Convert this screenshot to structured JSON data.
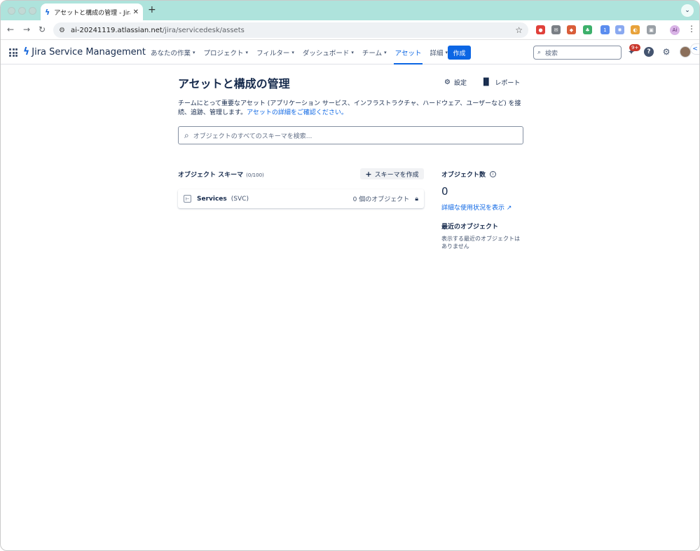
{
  "browser": {
    "tab_title": "アセットと構成の管理 - Jira Se",
    "url_host": "ai-20241119.atlassian.net",
    "url_path": "/jira/servicedesk/assets",
    "profile_initial": "Ai"
  },
  "app": {
    "product_name": "Jira Service Management",
    "nav": [
      {
        "label": "あなたの作業",
        "dropdown": true
      },
      {
        "label": "プロジェクト",
        "dropdown": true
      },
      {
        "label": "フィルター",
        "dropdown": true
      },
      {
        "label": "ダッシュボード",
        "dropdown": true
      },
      {
        "label": "チーム",
        "dropdown": true
      },
      {
        "label": "アセット",
        "dropdown": false,
        "active": true
      },
      {
        "label": "詳細",
        "dropdown": true
      }
    ],
    "create_label": "作成",
    "search_placeholder": "検索",
    "notifications_badge": "9+",
    "accent_color": "#0c66e4"
  },
  "page": {
    "title": "アセットと構成の管理",
    "settings_label": "設定",
    "report_label": "レポート",
    "description": "チームにとって重要なアセット (アプリケーション サービス、インフラストラクチャ、ハードウェア、ユーザーなど) を接続、追跡、管理します。",
    "description_link": "アセットの詳細をご確認ください。",
    "search_placeholder": "オブジェクトのすべてのスキーマを検索...",
    "schemas_heading": "オブジェクト スキーマ",
    "schemas_count": "(0/100)",
    "create_schema_label": "スキーマを作成",
    "schemas": [
      {
        "name": "Services",
        "key": "(SVC)",
        "object_count": "0 個のオブジェクト"
      }
    ],
    "object_count_heading": "オブジェクト数",
    "object_count": "0",
    "usage_link": "詳細な使用状況を表示",
    "recent_heading": "最近のオブジェクト",
    "recent_empty": "表示する最近のオブジェクトはありません"
  }
}
